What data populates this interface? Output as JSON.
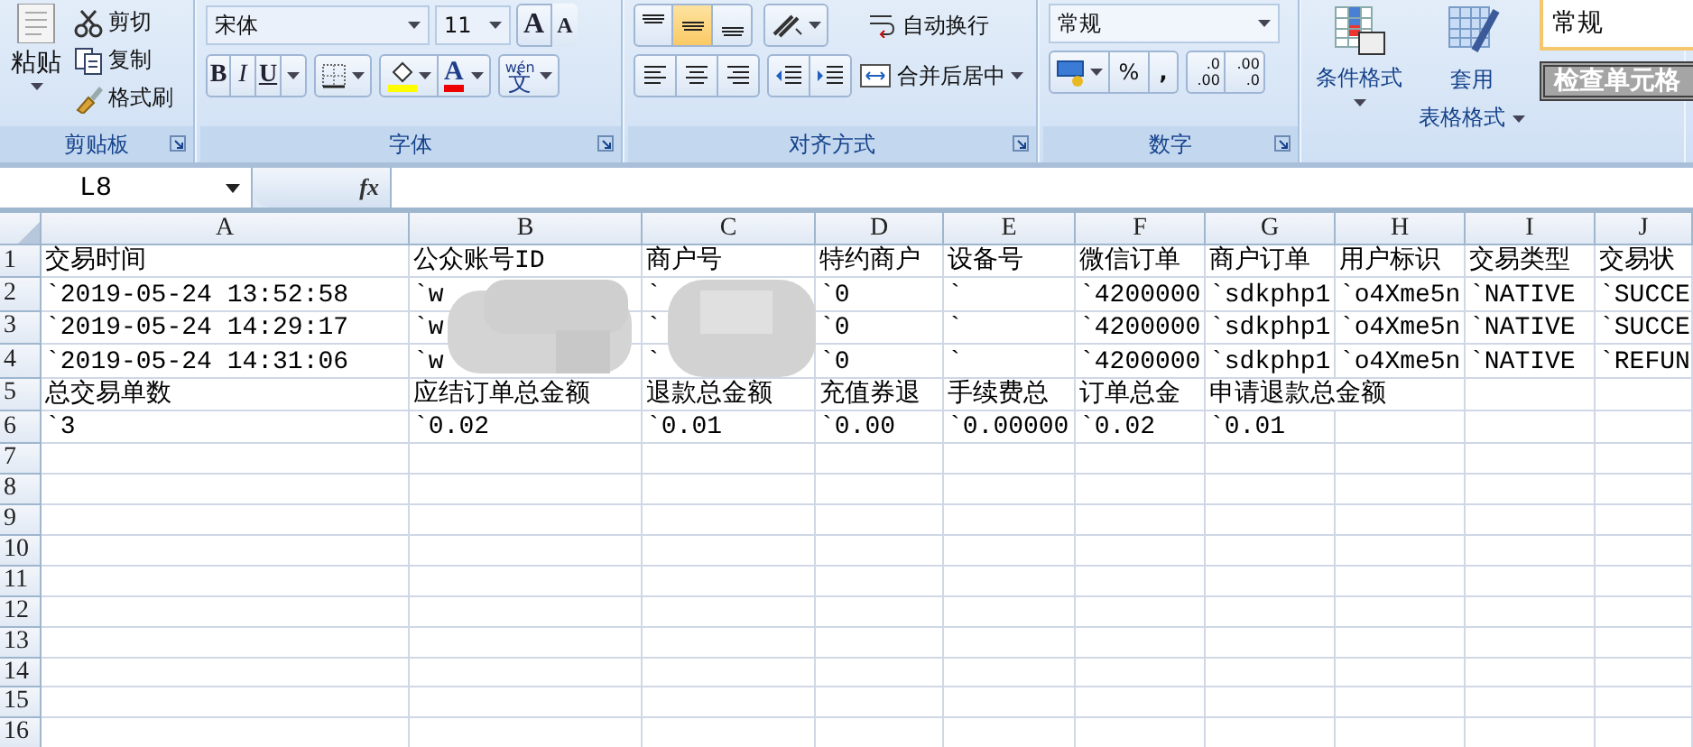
{
  "ribbon": {
    "groups": [
      {
        "kind": "clipboard",
        "label": "剪贴板",
        "paste": "粘贴",
        "items": [
          "剪切",
          "复制",
          "格式刷"
        ]
      },
      {
        "kind": "font",
        "label": "字体",
        "font_name": "宋体",
        "font_size": "11",
        "grow": "A",
        "shrink": "A",
        "styles": [
          "B",
          "I",
          "U"
        ],
        "phonetic_top": "wén",
        "phonetic": "文",
        "font_color_letter": "A"
      },
      {
        "kind": "alignment",
        "label": "对齐方式",
        "vertical_align": [
          {
            "selected": false
          },
          {
            "selected": true
          },
          {
            "selected": false
          }
        ],
        "wrap": "自动换行",
        "merge": "合并后居中"
      },
      {
        "kind": "number",
        "label": "数字",
        "format": "常规",
        "percent": "%",
        "comma": ",",
        "decimals": [
          {
            "top": ".0",
            "bottom": ".00"
          },
          {
            "top": ".00",
            "bottom": ".0"
          }
        ]
      },
      {
        "kind": "styles",
        "conditional": "条件格式",
        "table_format": [
          "套用",
          "表格格式"
        ],
        "cell_styles": [
          {
            "kind": "normal",
            "label": "常规"
          },
          {
            "kind": "check",
            "label": "检查单元格"
          }
        ]
      }
    ]
  },
  "formula_bar": {
    "name_box": "L8",
    "fx": "fx"
  },
  "sheet": {
    "columns": [
      "A",
      "B",
      "C",
      "D",
      "E",
      "F",
      "G",
      "H",
      "I",
      "J"
    ],
    "rows": [
      {
        "header": "1",
        "cells": [
          "交易时间",
          "公众账号ID",
          "商户号",
          "特约商户",
          "设备号",
          "微信订单",
          "商户订单",
          "用户标识",
          "交易类型",
          "交易状"
        ]
      },
      {
        "header": "2",
        "cells": [
          "`2019-05-24 13:52:58",
          "`w",
          "`",
          "`0",
          "`",
          "`4200000",
          "`sdkphp1",
          "`o4Xme5n",
          "`NATIVE",
          "`SUCCE"
        ]
      },
      {
        "header": "3",
        "cells": [
          "`2019-05-24 14:29:17",
          "`w",
          "`",
          "`0",
          "`",
          "`4200000",
          "`sdkphp1",
          "`o4Xme5n",
          "`NATIVE",
          "`SUCCE"
        ]
      },
      {
        "header": "4",
        "cells": [
          "`2019-05-24 14:31:06",
          "`w",
          "`",
          "`0",
          "`",
          "`4200000",
          "`sdkphp1",
          "`o4Xme5n",
          "`NATIVE",
          "`REFUN"
        ]
      },
      {
        "header": "5",
        "cells": [
          "总交易单数",
          "应结订单总金额",
          "退款总金额",
          "充值券退",
          "手续费总",
          "订单总金",
          "申请退款总金额",
          null,
          null,
          null
        ]
      },
      {
        "header": "6",
        "cells": [
          "`3",
          "`0.02",
          "`0.01",
          "`0.00",
          "`0.00000",
          "`0.02",
          "`0.01",
          null,
          null,
          null
        ]
      },
      {
        "header": "7"
      },
      {
        "header": "8"
      },
      {
        "header": "9"
      },
      {
        "header": "10"
      },
      {
        "header": "11"
      },
      {
        "header": "12"
      },
      {
        "header": "13"
      },
      {
        "header": "14"
      },
      {
        "header": "15"
      },
      {
        "header": "16"
      }
    ]
  }
}
